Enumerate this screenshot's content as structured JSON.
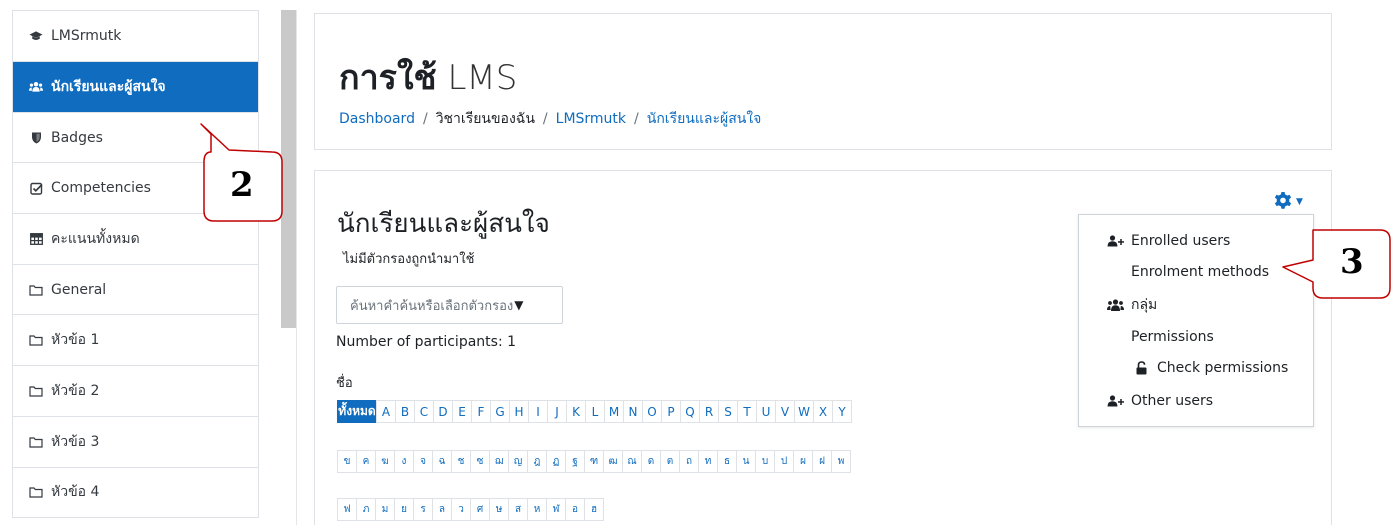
{
  "sidebar": {
    "items": [
      {
        "label": "LMSrmutk",
        "icon": "graduation-cap-icon"
      },
      {
        "label": "นักเรียนและผู้สนใจ",
        "icon": "users-icon",
        "active": true
      },
      {
        "label": "Badges",
        "icon": "shield-icon"
      },
      {
        "label": "Competencies",
        "icon": "check-square-icon"
      },
      {
        "label": "คะแนนทั้งหมด",
        "icon": "table-icon"
      },
      {
        "label": "General",
        "icon": "folder-icon"
      },
      {
        "label": "หัวข้อ 1",
        "icon": "folder-icon"
      },
      {
        "label": "หัวข้อ 2",
        "icon": "folder-icon"
      },
      {
        "label": "หัวข้อ 3",
        "icon": "folder-icon"
      },
      {
        "label": "หัวข้อ 4",
        "icon": "folder-icon"
      }
    ]
  },
  "header": {
    "title_bold": "การใช้",
    "title_light": "LMS",
    "breadcrumb": [
      {
        "label": "Dashboard",
        "link": true
      },
      {
        "label": "วิชาเรียนของฉัน",
        "link": false
      },
      {
        "label": "LMSrmutk",
        "link": true
      },
      {
        "label": "นักเรียนและผู้สนใจ",
        "link": true
      }
    ],
    "breadcrumb_separator": "/"
  },
  "main": {
    "title": "นักเรียนและผู้สนใจ",
    "no_filter": "ไม่มีตัวกรองถูกนำมาใช้",
    "search_placeholder": "ค้นหาคำค้นหรือเลือกตัวกรอง",
    "participants": "Number of participants: 1",
    "name_label": "ชื่อ",
    "all_label": "ทั้งหมด",
    "letters_en": [
      "A",
      "B",
      "C",
      "D",
      "E",
      "F",
      "G",
      "H",
      "I",
      "J",
      "K",
      "L",
      "M",
      "N",
      "O",
      "P",
      "Q",
      "R",
      "S",
      "T",
      "U",
      "V",
      "W",
      "X",
      "Y"
    ],
    "letters_th1": [
      "ข",
      "ค",
      "ฆ",
      "ง",
      "จ",
      "ฉ",
      "ช",
      "ซ",
      "ฌ",
      "ญ",
      "ฎ",
      "ฏ",
      "ฐ",
      "ฑ",
      "ฒ",
      "ณ",
      "ด",
      "ต",
      "ถ",
      "ท",
      "ธ",
      "น",
      "บ",
      "ป",
      "ผ",
      "ฝ",
      "พ"
    ],
    "letters_th2": [
      "ฟ",
      "ภ",
      "ม",
      "ย",
      "ร",
      "ล",
      "ว",
      "ศ",
      "ษ",
      "ส",
      "ห",
      "ฬ",
      "อ",
      "ฮ"
    ]
  },
  "gear_menu": {
    "icon": "gear-icon",
    "items": [
      {
        "label": "Enrolled users",
        "icon": "user-plus-icon"
      },
      {
        "label": "Enrolment methods",
        "icon": ""
      },
      {
        "label": "กลุ่ม",
        "icon": "users-icon"
      },
      {
        "label": "Permissions",
        "icon": ""
      },
      {
        "label": "Check permissions",
        "icon": "unlock-icon"
      },
      {
        "label": "Other users",
        "icon": "user-plus-icon"
      }
    ]
  },
  "callouts": {
    "two": "2",
    "three": "3"
  },
  "colors": {
    "accent": "#0f6cbf",
    "callout_border": "#c00000"
  }
}
